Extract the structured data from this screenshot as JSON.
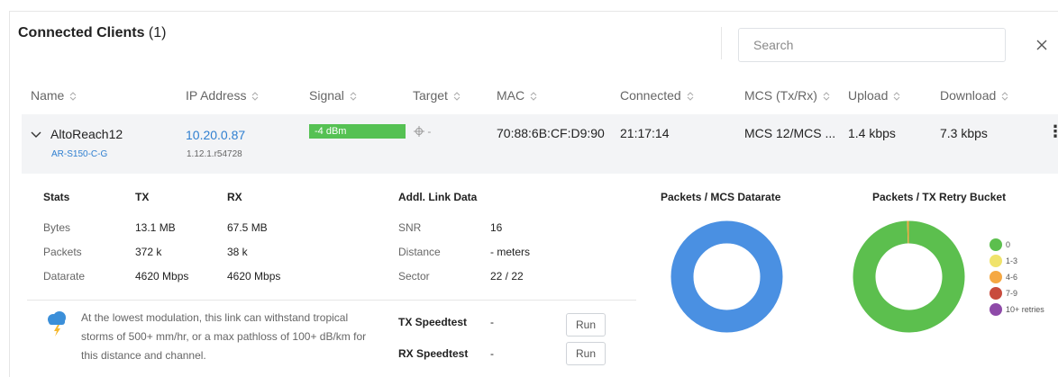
{
  "header": {
    "title": "Connected Clients",
    "count": "(1)",
    "search_placeholder": "Search"
  },
  "columns": [
    {
      "label": "Name"
    },
    {
      "label": "IP Address"
    },
    {
      "label": "Signal"
    },
    {
      "label": "Target"
    },
    {
      "label": "MAC"
    },
    {
      "label": "Connected"
    },
    {
      "label": "MCS (Tx/Rx)"
    },
    {
      "label": "Upload"
    },
    {
      "label": "Download"
    }
  ],
  "client": {
    "name": "AltoReach12",
    "model": "AR-S150-C-G",
    "ip": "10.20.0.87",
    "firmware": "1.12.1.r54728",
    "signal": "-4 dBm",
    "target": "-",
    "mac": "70:88:6B:CF:D9:90",
    "connected": "21:17:14",
    "mcs": "MCS 12/MCS ...",
    "upload": "1.4 kbps",
    "download": "7.3 kbps"
  },
  "stats": {
    "header": "Stats",
    "tx_header": "TX",
    "rx_header": "RX",
    "rows": [
      {
        "label": "Bytes",
        "tx": "13.1 MB",
        "rx": "67.5 MB"
      },
      {
        "label": "Packets",
        "tx": "372 k",
        "rx": "38 k"
      },
      {
        "label": "Datarate",
        "tx": "4620 Mbps",
        "rx": "4620 Mbps"
      }
    ]
  },
  "link_data": {
    "header": "Addl. Link Data",
    "rows": [
      {
        "label": "SNR",
        "value": "16"
      },
      {
        "label": "Distance",
        "value": "- meters"
      },
      {
        "label": "Sector",
        "value": "22 / 22"
      }
    ]
  },
  "weather_text": "At the lowest modulation, this link can withstand tropical storms of 500+ mm/hr, or a max pathloss of 100+ dB/km for this distance and channel.",
  "speedtest": {
    "tx_label": "TX Speedtest",
    "tx_value": "-",
    "rx_label": "RX Speedtest",
    "rx_value": "-",
    "run_label": "Run"
  },
  "charts": {
    "mcs_title": "Packets / MCS Datarate",
    "retry_title": "Packets / TX Retry Bucket"
  },
  "chart_data": [
    {
      "type": "pie",
      "title": "Packets / MCS Datarate",
      "slices": [
        {
          "value": 100,
          "color": "#4a90e2"
        }
      ]
    },
    {
      "type": "pie",
      "title": "Packets / TX Retry Bucket",
      "categories": [
        "0",
        "1-3",
        "4-6",
        "7-9",
        "10+ retries"
      ],
      "values": [
        99.5,
        0,
        0.5,
        0,
        0
      ],
      "colors": [
        "#5cbf4e",
        "#f0e36b",
        "#f5a843",
        "#c84b3d",
        "#8e4aa8"
      ]
    }
  ],
  "colors": {
    "signal_green": "#55c153",
    "link_blue": "#2f7fd0",
    "row_bg": "#f3f4f6"
  }
}
